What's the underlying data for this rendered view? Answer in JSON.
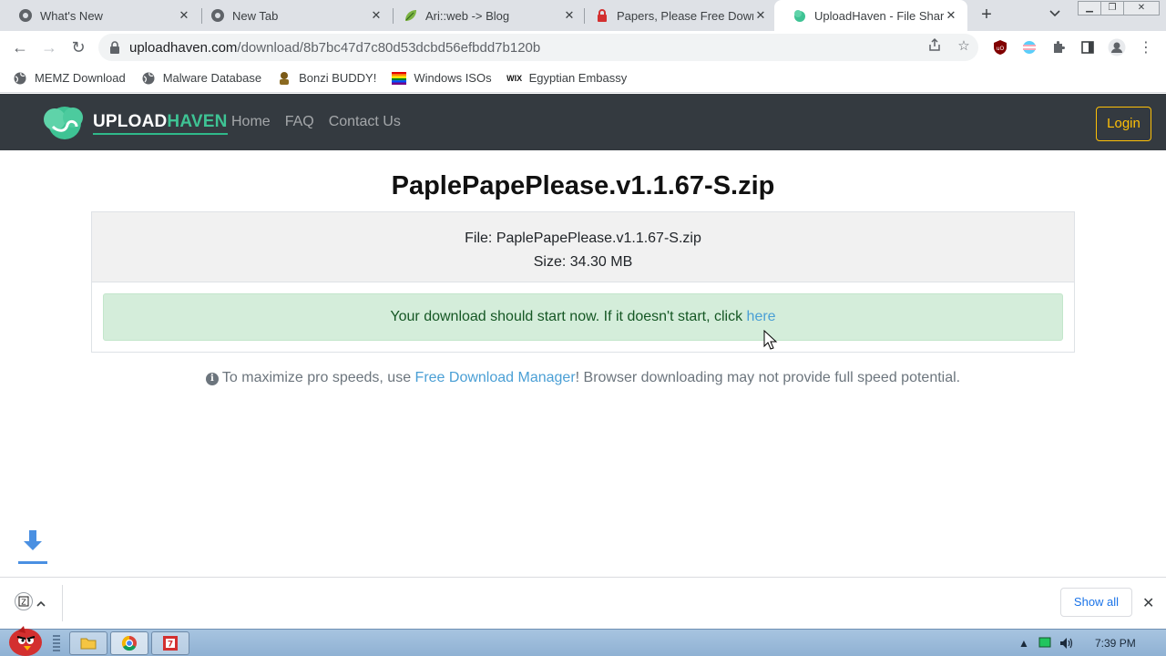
{
  "browser": {
    "tabs": [
      {
        "title": "What's New",
        "icon": "chrome-icon"
      },
      {
        "title": "New Tab",
        "icon": "chrome-icon"
      },
      {
        "title": "Ari::web -> Blog",
        "icon": "leaf-icon"
      },
      {
        "title": "Papers, Please Free Down",
        "icon": "lock-icon"
      },
      {
        "title": "UploadHaven - File Shari",
        "icon": "uploadhaven-icon",
        "active": true
      }
    ],
    "url_host": "uploadhaven.com",
    "url_path": "/download/8b7bc47d7c80d53dcbd56efbdd7b120b",
    "bookmarks": [
      {
        "label": "MEMZ Download",
        "icon": "globe-icon"
      },
      {
        "label": "Malware Database",
        "icon": "globe-icon"
      },
      {
        "label": "Bonzi BUDDY!",
        "icon": "bonzi-icon"
      },
      {
        "label": "Windows ISOs",
        "icon": "rainbow-flag-icon"
      },
      {
        "label": "Egyptian Embassy",
        "icon": "wix-icon"
      }
    ]
  },
  "site": {
    "logo_a": "UPLOAD",
    "logo_b": "HAVEN",
    "nav": [
      "Home",
      "FAQ",
      "Contact Us"
    ],
    "login": "Login",
    "title": "PaplePapePlease.v1.1.67-S.zip",
    "file_line": "File: PaplePapePlease.v1.1.67-S.zip",
    "size_line": "Size: 34.30 MB",
    "alert_text": "Your download should start now. If it doesn't start, click ",
    "alert_link": "here",
    "tip_before": "To maximize pro speeds, use ",
    "tip_link": "Free Download Manager",
    "tip_after": "! Browser downloading may not provide full speed potential.",
    "accent": "#3ec394",
    "login_color": "#ffc107"
  },
  "shelf": {
    "show_all": "Show all"
  },
  "taskbar": {
    "time": "7:39 PM"
  }
}
